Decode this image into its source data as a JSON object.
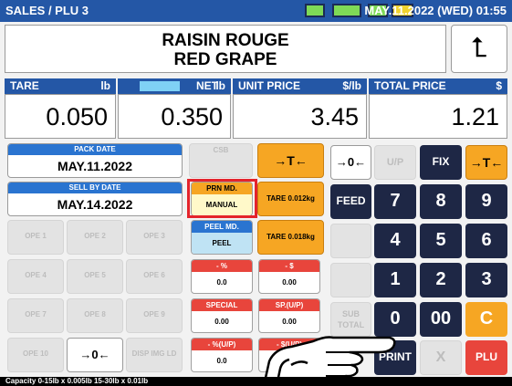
{
  "status": {
    "mode": "SALES / PLU 3",
    "datetime": "MAY.11.2022 (WED) 01:55"
  },
  "product": {
    "line1": "RAISIN ROUGE",
    "line2": "RED GRAPE"
  },
  "back_icon": "return-arrow-icon",
  "fields": {
    "tare": {
      "label": "TARE",
      "unit": "lb",
      "value": "0.050"
    },
    "net_wt": {
      "label": "NET WT",
      "unit": "lb",
      "value": "0.350"
    },
    "unit_price": {
      "label": "UNIT PRICE",
      "unit": "$/lb",
      "value": "3.45"
    },
    "total_price": {
      "label": "TOTAL PRICE",
      "unit": "$",
      "value": "1.21"
    }
  },
  "pack_date": {
    "label": "PACK DATE",
    "value": "MAY.11.2022"
  },
  "sell_by_date": {
    "label": "SELL BY DATE",
    "value": "MAY.14.2022"
  },
  "csb_label": "CSB",
  "prn_md": {
    "label": "PRN MD.",
    "value": "MANUAL"
  },
  "peel_md": {
    "label": "PEEL MD.",
    "value": "PEEL"
  },
  "tare_buttons": {
    "t1": "TARE 0.012kg",
    "t2": "TARE 0.018kg"
  },
  "ope": [
    "OPE 1",
    "OPE 2",
    "OPE 3",
    "OPE 4",
    "OPE 5",
    "OPE 6",
    "OPE 7",
    "OPE 8",
    "OPE 9",
    "OPE 10"
  ],
  "disp_img_label": "DISP IMG LD",
  "discounts": {
    "percent": {
      "label": "- %",
      "value": "0.0"
    },
    "dollar": {
      "label": "- $",
      "value": "0.00"
    },
    "special": {
      "label": "SPECIAL",
      "value": "0.00"
    },
    "sp_up": {
      "label": "SP.(U/P)",
      "value": "0.00"
    },
    "pct_up": {
      "label": "- %(U/P)",
      "value": "0.0"
    },
    "dollar_up": {
      "label": "- $(U/P)",
      "value": ""
    }
  },
  "keys": {
    "zero_adj": "→0←",
    "tare_key": "→T←",
    "up": "U/P",
    "fix": "FIX",
    "feed": "FEED",
    "sub_total": "SUB TOTAL",
    "n7": "7",
    "n8": "8",
    "n9": "9",
    "n4": "4",
    "n5": "5",
    "n6": "6",
    "n1": "1",
    "n2": "2",
    "n3": "3",
    "n0": "0",
    "n00": "00",
    "c": "C",
    "print": "PRINT",
    "x": "X",
    "plu": "PLU"
  },
  "capacity": "Capacity 0-15lb x 0.005lb   15-30lb x 0.01lb",
  "colors": {
    "topbar": "#2457a6",
    "orange": "#f6a623",
    "red": "#e8453c",
    "dark_key": "#1e2745",
    "highlight": "#e4232b"
  }
}
